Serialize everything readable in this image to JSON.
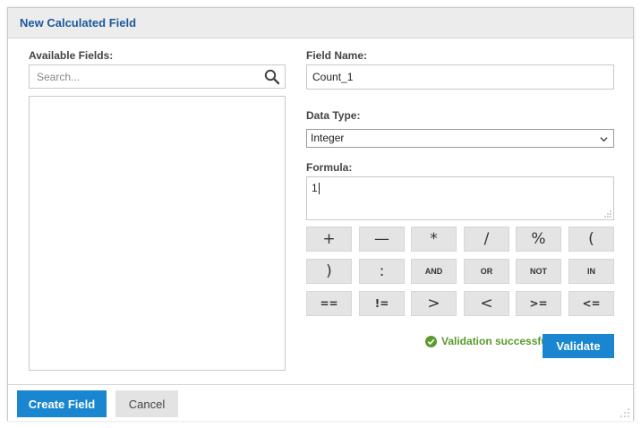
{
  "dialog": {
    "title": "New Calculated Field"
  },
  "available_fields": {
    "label": "Available Fields:",
    "search_placeholder": "Search..."
  },
  "field_name": {
    "label": "Field Name:",
    "value": "Count_1"
  },
  "data_type": {
    "label": "Data Type:",
    "selected": "Integer"
  },
  "formula": {
    "label": "Formula:",
    "value": "1"
  },
  "operators": {
    "row1": [
      "+",
      "—",
      "*",
      "/",
      "%",
      "("
    ],
    "row2": [
      ")",
      ":",
      "AND",
      "OR",
      "NOT",
      "IN"
    ],
    "row3": [
      "==",
      "!=",
      ">",
      "<",
      ">=",
      "<="
    ]
  },
  "validation": {
    "text": "Validation successful",
    "color": "#5a9a2a"
  },
  "buttons": {
    "validate": "Validate",
    "create": "Create Field",
    "cancel": "Cancel"
  },
  "colors": {
    "accent": "#1a86d0",
    "title": "#1a5a9a"
  },
  "icons": {
    "search": "search-icon",
    "select": "chevron-down-icon",
    "status": "check-circle-icon",
    "resize": "resize-grip-icon"
  }
}
